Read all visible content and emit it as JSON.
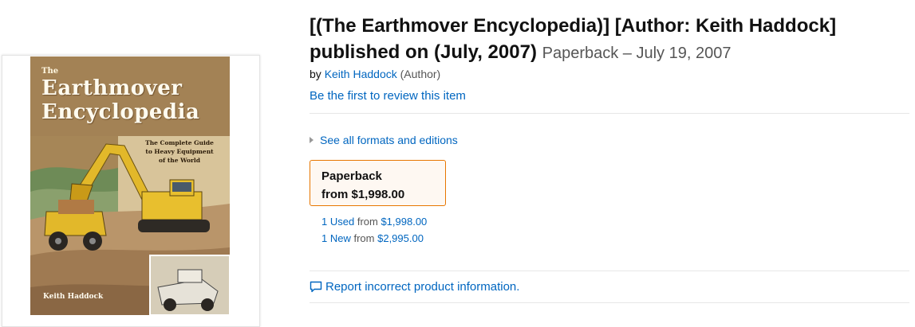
{
  "product": {
    "title": "[(The Earthmover Encyclopedia)] [Author: Keith Haddock] published on (July, 2007)",
    "format_date": "Paperback – July 19, 2007",
    "by_label": "by",
    "author_name": "Keith Haddock",
    "author_role": "(Author)",
    "review_link": "Be the first to review this item"
  },
  "cover": {
    "the": "The",
    "title": "Earthmover\nEncyclopedia",
    "subtitle": "The Complete Guide\nto Heavy Equipment\nof the World",
    "author": "Keith Haddock"
  },
  "formats": {
    "see_all": "See all formats and editions",
    "box_format": "Paperback",
    "box_price": "from $1,998.00",
    "offers": [
      {
        "count": "1 Used",
        "from": "from",
        "price": "$1,998.00"
      },
      {
        "count": "1 New",
        "from": "from",
        "price": "$2,995.00"
      }
    ]
  },
  "report": {
    "label": "Report incorrect product information."
  },
  "colors": {
    "link": "#0066c0",
    "selected_border": "#e77600",
    "selected_bg": "#fef8f2",
    "muted_text": "#555555"
  },
  "icons": {
    "expand": "triangle-right-icon",
    "report": "speech-bubble-icon"
  }
}
